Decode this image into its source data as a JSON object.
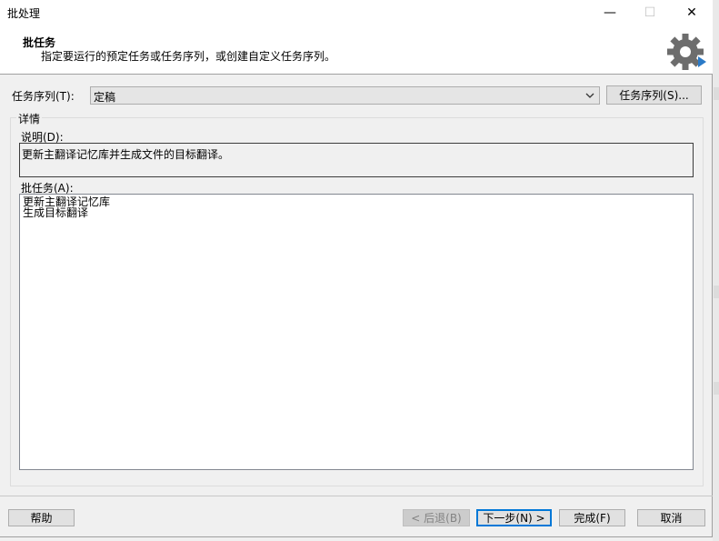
{
  "window": {
    "title": "批处理",
    "controls": {
      "minimize": "—",
      "maximize": "☐",
      "close": "✕"
    }
  },
  "header": {
    "title": "批任务",
    "description": "指定要运行的预定任务或任务序列，或创建自定义任务序列。",
    "icon": "gear-icon"
  },
  "sequence": {
    "label": "任务序列(T):",
    "selected": "定稿",
    "button": "任务序列(S)..."
  },
  "details": {
    "group_title": "详情",
    "description_label": "说明(D):",
    "description_value": "更新主翻译记忆库并生成文件的目标翻译。",
    "tasks_label": "批任务(A):",
    "tasks": [
      "更新主翻译记忆库",
      "生成目标翻译"
    ]
  },
  "footer": {
    "help": "帮助",
    "back": "< 后退(B)",
    "next": "下一步(N) >",
    "finish": "完成(F)",
    "cancel": "取消"
  },
  "colors": {
    "accent": "#0078d7",
    "gear": "#6d6d6d",
    "gear_arrow": "#2a7ac7"
  }
}
